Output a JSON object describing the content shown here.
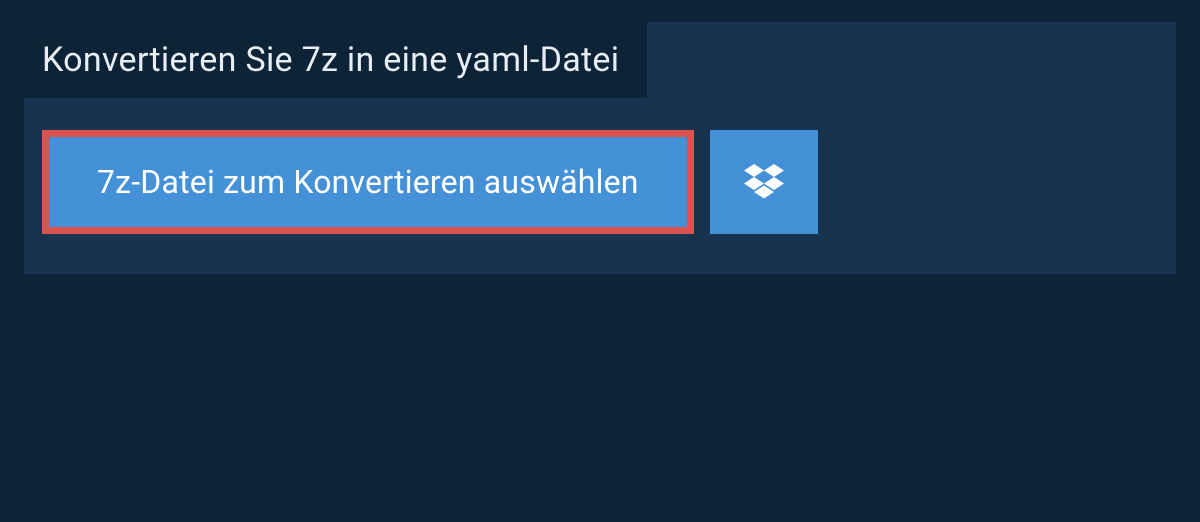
{
  "colors": {
    "page_bg": "#0d2438",
    "panel_bg": "#163450",
    "button_bg": "#4491d8",
    "highlight_border": "#d9544f",
    "text_light": "#e8eef3"
  },
  "heading": {
    "text": "Konvertieren Sie 7z in eine yaml-Datei"
  },
  "buttons": {
    "select_file_label": "7z-Datei zum Konvertieren auswählen",
    "dropbox_icon": "dropbox-icon"
  }
}
